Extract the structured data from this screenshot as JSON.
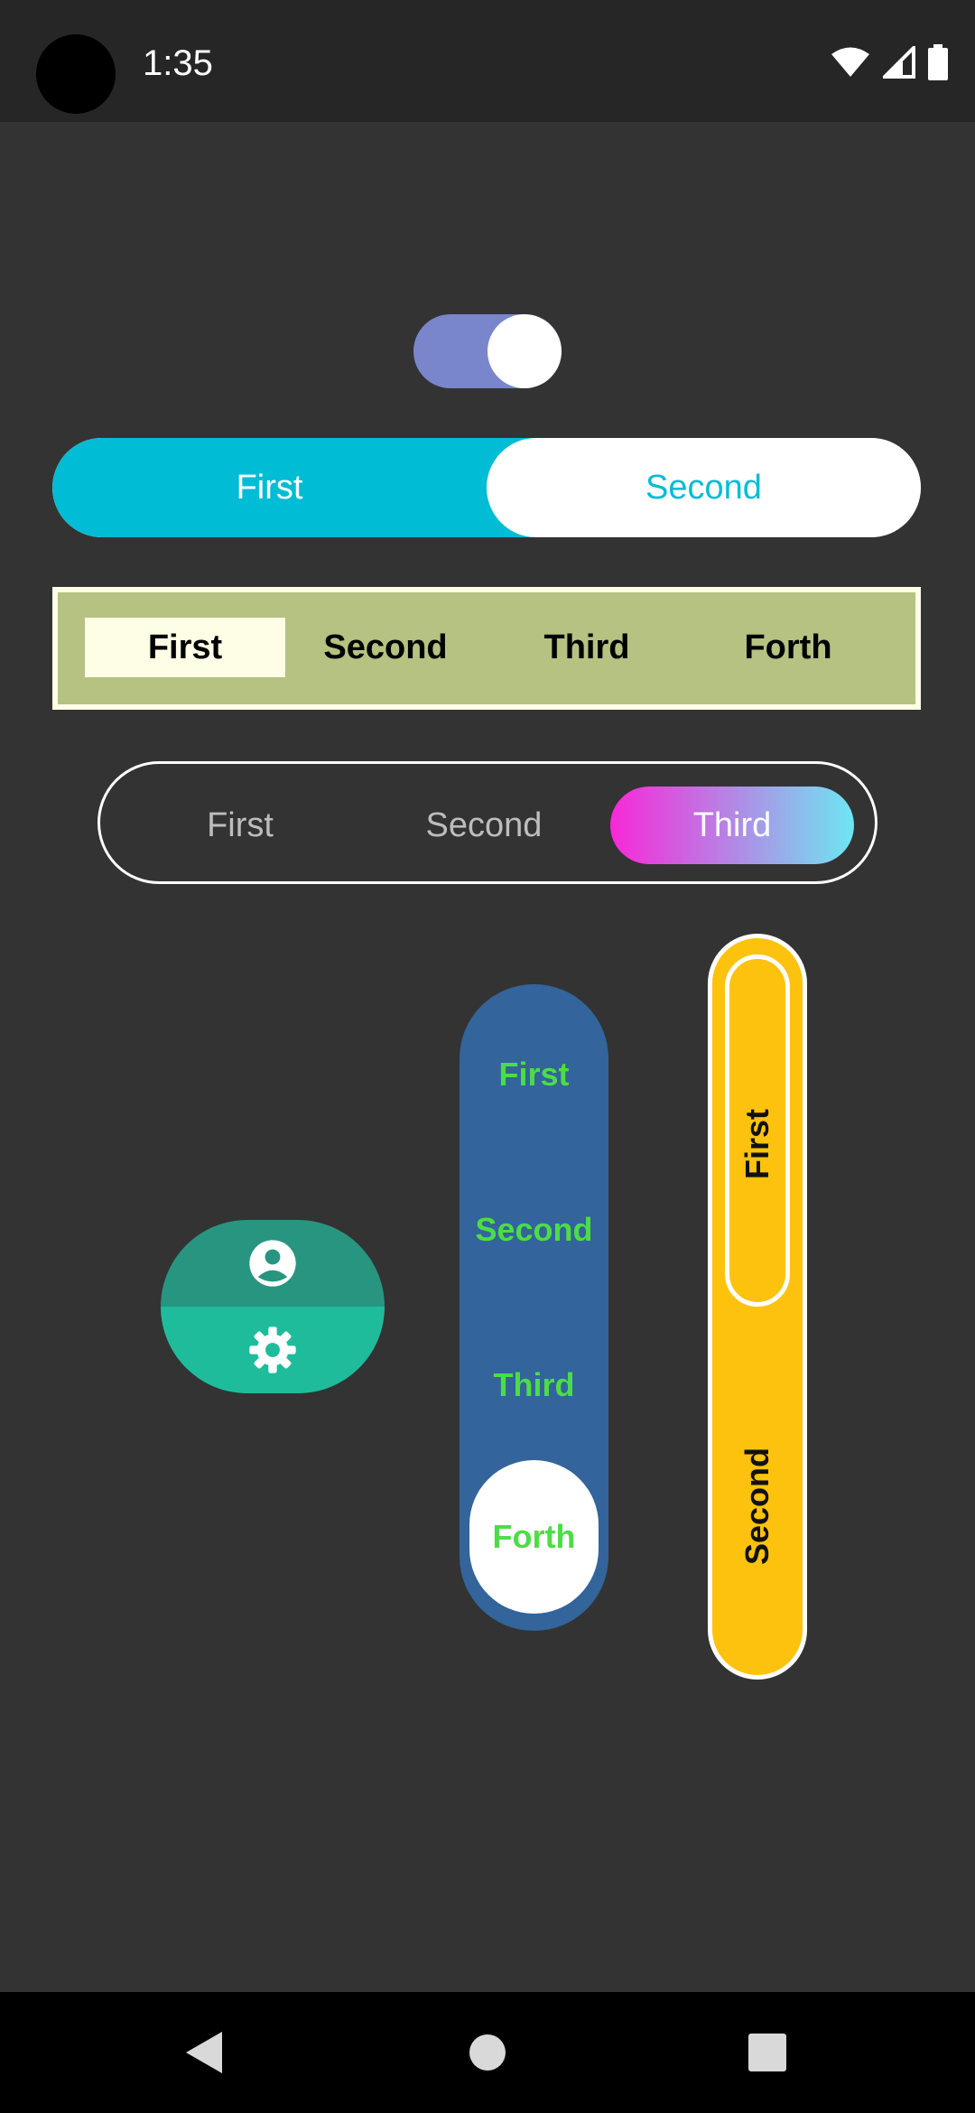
{
  "status_bar": {
    "time": "1:35",
    "icons": [
      "wifi-icon",
      "signal-icon",
      "battery-icon"
    ]
  },
  "toggle": {
    "state": "on",
    "track_color": "#7986cb",
    "knob_color": "#ffffff"
  },
  "segmented_pill": {
    "options": [
      "First",
      "Second"
    ],
    "selected_index": 0,
    "accent_color": "#00bcd4"
  },
  "segmented_box": {
    "options": [
      "First",
      "Second",
      "Third",
      "Forth"
    ],
    "selected_index": 0,
    "background_color": "#b5c282"
  },
  "segmented_outline": {
    "options": [
      "First",
      "Second",
      "Third"
    ],
    "selected_index": 2,
    "gradient": [
      "#f828d8",
      "#6ee6f2"
    ]
  },
  "icon_toggle": {
    "items": [
      "account-circle-icon",
      "settings-gear-icon"
    ],
    "colors": [
      "#289580",
      "#1fbc9c"
    ]
  },
  "vertical_blue": {
    "options": [
      "First",
      "Second",
      "Third",
      "Forth"
    ],
    "selected_index": 3,
    "background_color": "#33649b",
    "text_color": "#4cdd46"
  },
  "vertical_yellow": {
    "options": [
      "First",
      "Second"
    ],
    "selected_index": 0,
    "background_color": "#fdc20d"
  },
  "nav_bar": {
    "buttons": [
      "back-icon",
      "home-icon",
      "recents-icon"
    ]
  }
}
